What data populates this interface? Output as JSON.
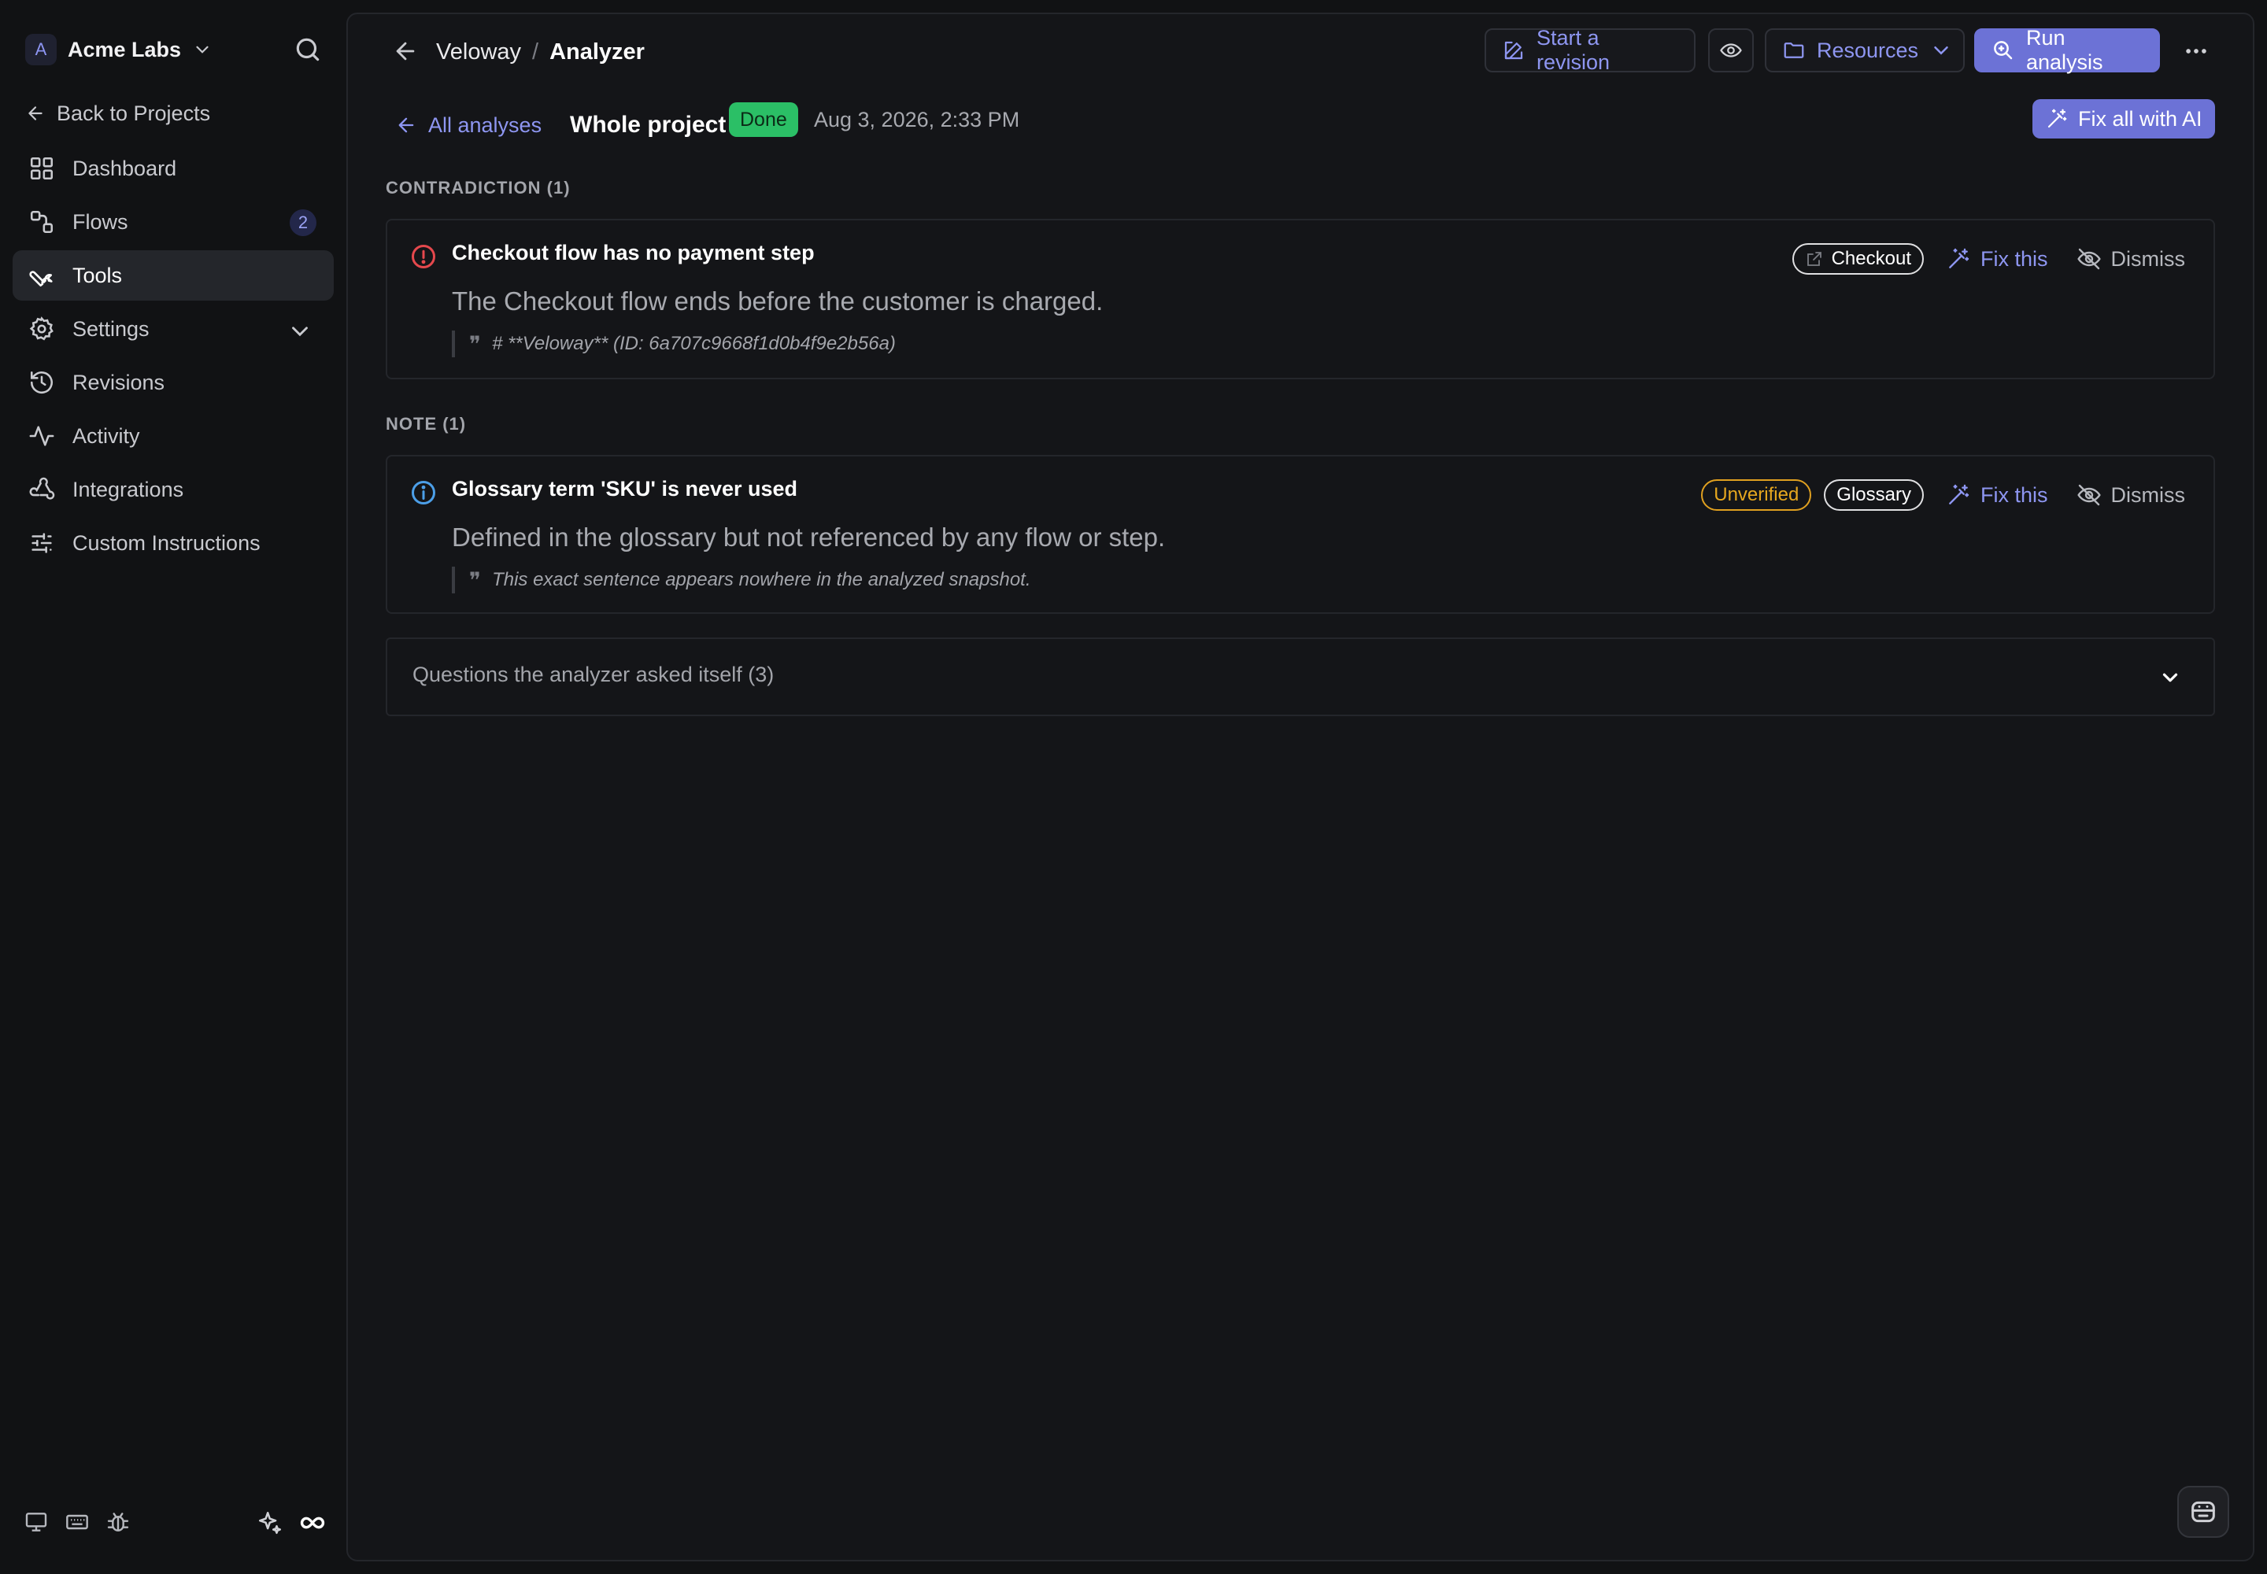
{
  "workspace": {
    "initial": "A",
    "name": "Acme Labs"
  },
  "sidebar": {
    "back_label": "Back to Projects",
    "items": [
      {
        "label": "Dashboard",
        "icon": "grid-icon"
      },
      {
        "label": "Flows",
        "icon": "flows-icon",
        "badge": "2"
      },
      {
        "label": "Tools",
        "icon": "wrench-icon",
        "active": true
      },
      {
        "label": "Settings",
        "icon": "gear-icon"
      },
      {
        "label": "Revisions",
        "icon": "history-icon"
      },
      {
        "label": "Activity",
        "icon": "activity-icon"
      },
      {
        "label": "Integrations",
        "icon": "webhook-icon"
      },
      {
        "label": "Custom Instructions",
        "icon": "sliders-icon"
      }
    ],
    "footer_icons": [
      "monitor-icon",
      "keyboard-icon",
      "bug-icon",
      "sparkles-icon",
      "infinity-icon"
    ]
  },
  "header": {
    "project": "Veloway",
    "separator": "/",
    "page": "Analyzer",
    "start_revision_label": "Start a revision",
    "resources_label": "Resources",
    "run_analysis_label": "Run analysis"
  },
  "subbar": {
    "all_analyses_label": "All analyses",
    "scope": "Whole project",
    "status": "Done",
    "date": "Aug 3, 2026, 2:33 PM",
    "fix_all_label": "Fix all with AI"
  },
  "sections": [
    {
      "label": "CONTRADICTION (1)",
      "findings": [
        {
          "severity_icon": "alert-circle-icon",
          "severity_color": "#e5484d",
          "title": "Checkout flow has no payment step",
          "description": "The Checkout flow ends before the customer is charged.",
          "quote": "# **Veloway** (ID: 6a707c9668f1d0b4f9e2b56a)",
          "tags": [
            {
              "label": "Checkout",
              "icon": "external-link-icon"
            }
          ],
          "fix_label": "Fix this",
          "dismiss_label": "Dismiss"
        }
      ]
    },
    {
      "label": "NOTE (1)",
      "findings": [
        {
          "severity_icon": "info-circle-icon",
          "severity_color": "#4c9fe8",
          "title": "Glossary term 'SKU' is never used",
          "description": "Defined in the glossary but not referenced by any flow or step.",
          "quote": "This exact sentence appears nowhere in the analyzed snapshot.",
          "tags": [
            {
              "label": "Unverified",
              "variant": "warning"
            },
            {
              "label": "Glossary"
            }
          ],
          "fix_label": "Fix this",
          "dismiss_label": "Dismiss"
        }
      ]
    }
  ],
  "accordion": {
    "label": "Questions the analyzer asked itself (3)"
  },
  "colors": {
    "accent": "#6c72d6",
    "accent_text": "#8e96f1",
    "done": "#2bbf66",
    "warning": "#e6a71f",
    "background": "#111214"
  }
}
